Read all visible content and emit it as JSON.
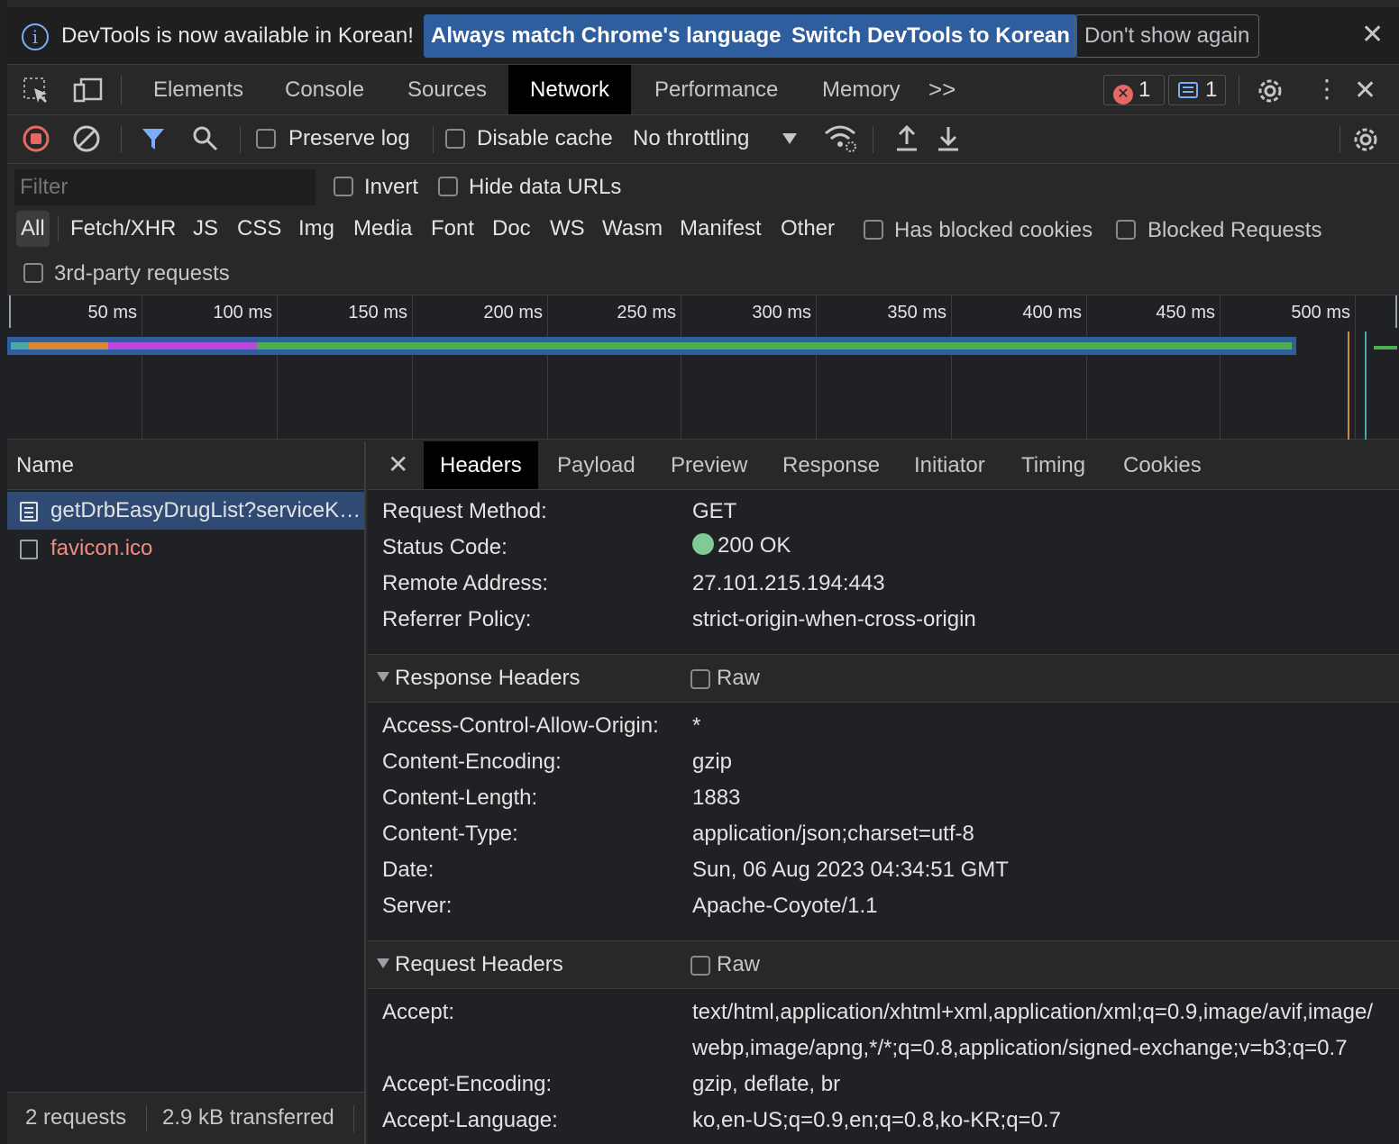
{
  "infobar": {
    "message": "DevTools is now available in Korean!",
    "match_button": "Always match Chrome's language",
    "switch_button": "Switch DevTools to Korean",
    "dismiss_button": "Don't show again"
  },
  "tabs": {
    "elements": "Elements",
    "console": "Console",
    "sources": "Sources",
    "network": "Network",
    "performance": "Performance",
    "memory": "Memory",
    "more": ">>",
    "error_count": "1",
    "message_count": "1"
  },
  "toolbar": {
    "preserve_log": "Preserve log",
    "disable_cache": "Disable cache",
    "throttling": "No throttling"
  },
  "filter": {
    "placeholder": "Filter",
    "invert": "Invert",
    "hide_data_urls": "Hide data URLs",
    "types": [
      "All",
      "Fetch/XHR",
      "JS",
      "CSS",
      "Img",
      "Media",
      "Font",
      "Doc",
      "WS",
      "Wasm",
      "Manifest",
      "Other"
    ],
    "has_blocked_cookies": "Has blocked cookies",
    "blocked_requests": "Blocked Requests",
    "third_party": "3rd-party requests"
  },
  "overview": {
    "ticks": [
      "50 ms",
      "100 ms",
      "150 ms",
      "200 ms",
      "250 ms",
      "300 ms",
      "350 ms",
      "400 ms",
      "450 ms",
      "500 ms"
    ]
  },
  "requests": {
    "header": "Name",
    "items": [
      {
        "name": "getDrbEasyDrugList?serviceKey=..."
      },
      {
        "name": "favicon.ico"
      }
    ],
    "count": "2 requests",
    "transferred": "2.9 kB transferred"
  },
  "details": {
    "tabs": [
      "Headers",
      "Payload",
      "Preview",
      "Response",
      "Initiator",
      "Timing",
      "Cookies"
    ],
    "general": [
      {
        "key": "Request Method:",
        "value": "GET"
      },
      {
        "key": "Status Code:",
        "value": "200 OK"
      },
      {
        "key": "Remote Address:",
        "value": "27.101.215.194:443"
      },
      {
        "key": "Referrer Policy:",
        "value": "strict-origin-when-cross-origin"
      }
    ],
    "response_headers_title": "Response Headers",
    "request_headers_title": "Request Headers",
    "raw_label": "Raw",
    "response_headers": [
      {
        "key": "Access-Control-Allow-Origin:",
        "value": "*"
      },
      {
        "key": "Content-Encoding:",
        "value": "gzip"
      },
      {
        "key": "Content-Length:",
        "value": "1883"
      },
      {
        "key": "Content-Type:",
        "value": "application/json;charset=utf-8"
      },
      {
        "key": "Date:",
        "value": "Sun, 06 Aug 2023 04:34:51 GMT"
      },
      {
        "key": "Server:",
        "value": "Apache-Coyote/1.1"
      }
    ],
    "request_headers": [
      {
        "key": "Accept:",
        "value": "text/html,application/xhtml+xml,application/xml;q=0.9,image/avif,image/",
        "value2": "webp,image/apng,*/*;q=0.8,application/signed-exchange;v=b3;q=0.7"
      },
      {
        "key": "Accept-Encoding:",
        "value": "gzip, deflate, br"
      },
      {
        "key": "Accept-Language:",
        "value": "ko,en-US;q=0.9,en;q=0.8,ko-KR;q=0.7"
      }
    ]
  },
  "colors": {
    "accent_blue": "#2f5e9f",
    "timeline_queue": "#d18a3a",
    "timeline_wait": "#b94ae0",
    "timeline_download": "#4caf50",
    "status_green": "#81c995",
    "error_red": "#f28b82"
  }
}
